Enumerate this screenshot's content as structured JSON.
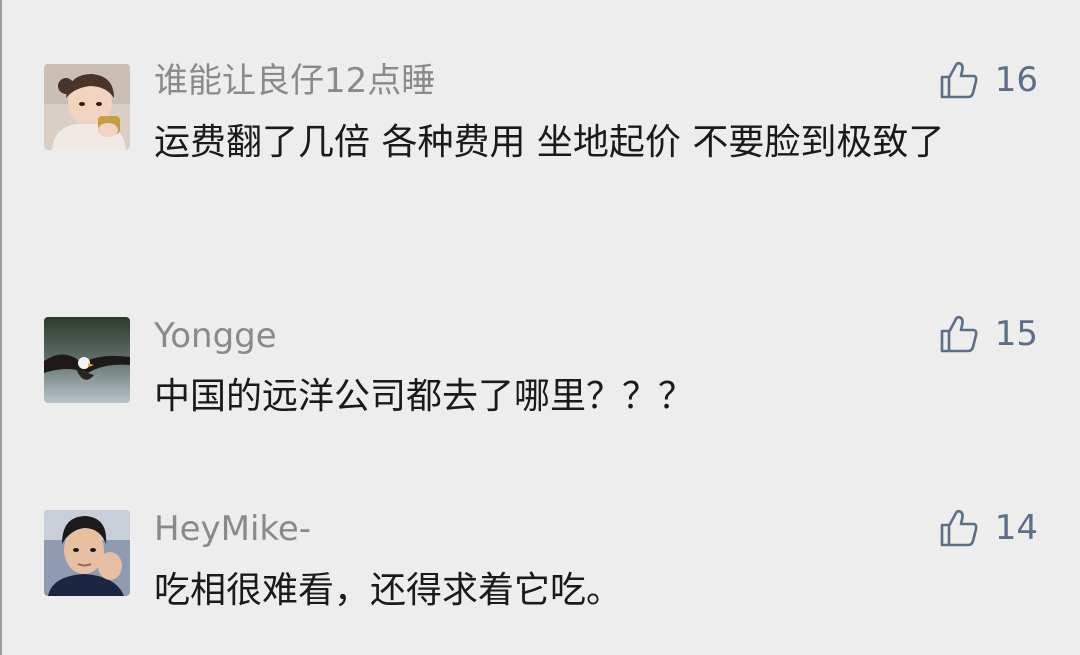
{
  "comments": [
    {
      "username": "谁能让良仔12点睡",
      "likes": "16",
      "content": "运费翻了几倍 各种费用 坐地起价 不要脸到极致了",
      "avatar_icon": "child-photo-avatar"
    },
    {
      "username": "Yongge",
      "likes": "15",
      "content": "中国的远洋公司都去了哪里？？？",
      "avatar_icon": "eagle-photo-avatar"
    },
    {
      "username": "HeyMike-",
      "likes": "14",
      "content": "吃相很难看，还得求着它吃。",
      "avatar_icon": "man-photo-avatar"
    }
  ],
  "like_icon": "thumbs-up-icon",
  "colors": {
    "background": "#ededed",
    "username": "#8a8a8a",
    "content": "#1a1a1a",
    "like": "#5c6f86"
  }
}
